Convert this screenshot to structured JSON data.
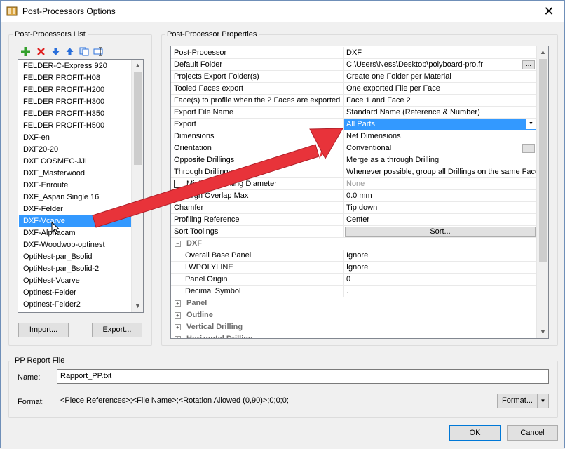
{
  "window": {
    "title": "Post-Processors Options",
    "close_glyph": "✕"
  },
  "left_panel": {
    "title": "Post-Processors List",
    "toolbar": [
      "add-icon",
      "delete-icon",
      "move-down-icon",
      "move-up-icon",
      "copy-icon",
      "rename-icon"
    ],
    "items": [
      "FELDER-C-Express 920",
      "FELDER PROFIT-H08",
      "FELDER PROFIT-H200",
      "FELDER PROFIT-H300",
      "FELDER PROFIT-H350",
      "FELDER PROFIT-H500",
      "DXF-en",
      "DXF20-20",
      "DXF COSMEC-JJL",
      "DXF_Masterwood",
      "DXF-Enroute",
      "DXF_Aspan Single 16",
      "DXF-Felder",
      "DXF-Vcarve",
      "DXF-Alphacam",
      "DXF-Woodwop-optinest",
      "OptiNest-par_Bsolid",
      "OptiNest-par_Bsolid-2",
      "OptiNest-Vcarve",
      "Optinest-Felder",
      "Optinest-Felder2"
    ],
    "selected_index": 13,
    "import_label": "Import...",
    "export_label": "Export..."
  },
  "right_panel": {
    "title": "Post-Processor Properties",
    "rows": [
      {
        "name": "Post-Processor",
        "value": "DXF"
      },
      {
        "name": "Default Folder",
        "value": "C:\\Users\\Ness\\Desktop\\polyboard-pro.fr",
        "button": "..."
      },
      {
        "name": "Projects Export Folder(s)",
        "value": "Create one Folder per Material"
      },
      {
        "name": "Tooled Faces export",
        "value": "One exported File per Face"
      },
      {
        "name": "Face(s) to profile when the 2 Faces are exported",
        "value": "Face 1 and Face 2"
      },
      {
        "name": "Export File Name",
        "value": "Standard Name (Reference & Number)"
      },
      {
        "name": "Export",
        "value": "All Parts",
        "selected": true,
        "dropdown": "▼"
      },
      {
        "name": "Dimensions",
        "value": "Net Dimensions"
      },
      {
        "name": "Orientation",
        "value": "Conventional",
        "button": "..."
      },
      {
        "name": "Opposite Drillings",
        "value": "Merge as a through Drilling"
      },
      {
        "name": "Through Drillings",
        "value": "Whenever possible, group all Drillings on the same Face"
      },
      {
        "name": "Minimum Drilling Diameter",
        "value": "None",
        "checkbox": true,
        "grey": true
      },
      {
        "name": "Through Overlap Max",
        "value": "0.0 mm"
      },
      {
        "name": "Chamfer",
        "value": "Tip down"
      },
      {
        "name": "Profiling Reference",
        "value": "Center"
      },
      {
        "name": "Sort Toolings",
        "sort_button": "Sort..."
      }
    ],
    "category_dxf": {
      "name": "DXF",
      "expander": "−"
    },
    "dxf_rows": [
      {
        "name": "Overall Base Panel",
        "value": "Ignore"
      },
      {
        "name": "LWPOLYLINE",
        "value": "Ignore"
      },
      {
        "name": "Panel Origin",
        "value": "0"
      },
      {
        "name": "Decimal Symbol",
        "value": "."
      }
    ],
    "collapsed_categories": [
      {
        "name": "Panel",
        "expander": "+"
      },
      {
        "name": "Outline",
        "expander": "+"
      },
      {
        "name": "Vertical Drilling",
        "expander": "+"
      },
      {
        "name": "Horizontal Drilling",
        "expander": "+"
      }
    ]
  },
  "report": {
    "title": "PP Report File",
    "name_label": "Name:",
    "name_value": "Rapport_PP.txt",
    "format_label": "Format:",
    "format_value": "<Piece References>;<File Name>;<Rotation Allowed (0,90)>;0;0;0;",
    "format_button": "Format...",
    "format_arrow": "▼"
  },
  "buttons": {
    "ok": "OK",
    "cancel": "Cancel"
  },
  "colors": {
    "selection": "#3399ff",
    "annotation_arrow": "#e8333a"
  }
}
